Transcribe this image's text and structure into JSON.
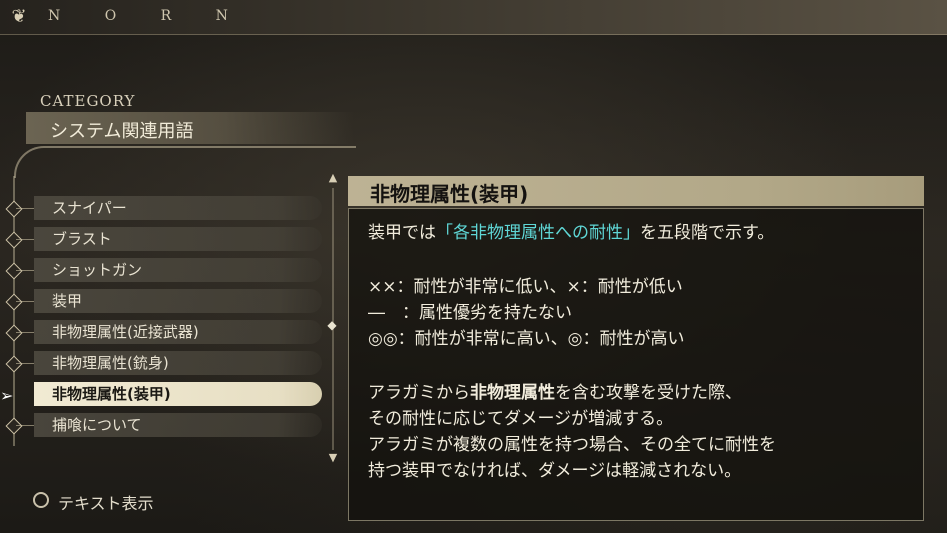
{
  "brand": "N O R N",
  "category": {
    "label": "CATEGORY",
    "title": "システム関連用語"
  },
  "menu": {
    "items": [
      {
        "label": "スナイパー"
      },
      {
        "label": "ブラスト"
      },
      {
        "label": "ショットガン"
      },
      {
        "label": "装甲"
      },
      {
        "label": "非物理属性(近接武器)"
      },
      {
        "label": "非物理属性(銃身)"
      },
      {
        "label": "非物理属性(装甲)"
      },
      {
        "label": "捕喰について"
      }
    ],
    "selected_index": 6
  },
  "detail": {
    "title": "非物理属性(装甲)",
    "intro_before": "装甲では",
    "intro_highlight": "「各非物理属性への耐性」",
    "intro_after": "を五段階で示す。",
    "legend": [
      "××：耐性が非常に低い、×：耐性が低い",
      "―　：属性優劣を持たない",
      "◎◎：耐性が非常に高い、◎：耐性が高い"
    ],
    "para1_before": "アラガミから",
    "para1_bold": "非物理属性",
    "para1_after": "を含む攻撃を受けた際、",
    "para2": "その耐性に応じてダメージが増減する。",
    "para3": "アラガミが複数の属性を持つ場合、その全てに耐性を",
    "para4": "持つ装甲でなければ、ダメージは軽減されない。"
  },
  "footer": {
    "button_label": "テキスト表示",
    "icon": "circle-button-icon"
  },
  "colors": {
    "highlight": "#5fd7d6",
    "selected_bg": "#f1ead3",
    "header_bg": "#bdb294"
  }
}
